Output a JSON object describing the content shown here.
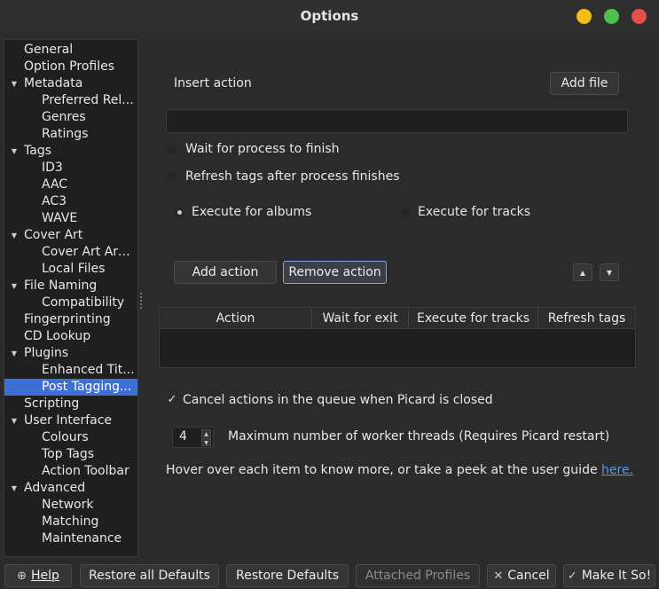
{
  "window": {
    "title": "Options",
    "colors": {
      "close": "#e2504d",
      "maximize": "#4fbf50",
      "minimize": "#f1bd17",
      "selection": "#3d6fd6",
      "link": "#4f9cf0"
    }
  },
  "tree": {
    "items": [
      {
        "label": "General",
        "level": 0
      },
      {
        "label": "Option Profiles",
        "level": 0
      },
      {
        "label": "Metadata",
        "level": 0,
        "expanded": true
      },
      {
        "label": "Preferred Rel...",
        "level": 1
      },
      {
        "label": "Genres",
        "level": 1
      },
      {
        "label": "Ratings",
        "level": 1
      },
      {
        "label": "Tags",
        "level": 0,
        "expanded": true
      },
      {
        "label": "ID3",
        "level": 1
      },
      {
        "label": "AAC",
        "level": 1
      },
      {
        "label": "AC3",
        "level": 1
      },
      {
        "label": "WAVE",
        "level": 1
      },
      {
        "label": "Cover Art",
        "level": 0,
        "expanded": true
      },
      {
        "label": "Cover Art Arc...",
        "level": 1
      },
      {
        "label": "Local Files",
        "level": 1
      },
      {
        "label": "File Naming",
        "level": 0,
        "expanded": true
      },
      {
        "label": "Compatibility",
        "level": 1
      },
      {
        "label": "Fingerprinting",
        "level": 0
      },
      {
        "label": "CD Lookup",
        "level": 0
      },
      {
        "label": "Plugins",
        "level": 0,
        "expanded": true
      },
      {
        "label": "Enhanced Tit...",
        "level": 1
      },
      {
        "label": "Post Tagging...",
        "level": 1,
        "selected": true
      },
      {
        "label": "Scripting",
        "level": 0
      },
      {
        "label": "User Interface",
        "level": 0,
        "expanded": true
      },
      {
        "label": "Colours",
        "level": 1
      },
      {
        "label": "Top Tags",
        "level": 1
      },
      {
        "label": "Action Toolbar",
        "level": 1
      },
      {
        "label": "Advanced",
        "level": 0,
        "expanded": true
      },
      {
        "label": "Network",
        "level": 1
      },
      {
        "label": "Matching",
        "level": 1
      },
      {
        "label": "Maintenance",
        "level": 1
      }
    ]
  },
  "main": {
    "insert_action_label": "Insert action",
    "add_file_button": "Add file",
    "command_value": "",
    "wait_process_label": "Wait for process to finish",
    "refresh_tags_label": "Refresh tags after process finishes",
    "execute_albums_label": "Execute for albums",
    "execute_tracks_label": "Execute for tracks",
    "add_action_button": "Add action",
    "remove_action_button": "Remove action",
    "table": {
      "columns": [
        "Action",
        "Wait for exit",
        "Execute for tracks",
        "Refresh tags"
      ]
    },
    "cancel_queue_label": "Cancel actions in the queue when Picard is closed",
    "threads_value": "4",
    "threads_label": "Maximum number of worker threads (Requires Picard restart)",
    "hint_text": "Hover over each item to know more, or take a peek at the user guide ",
    "hint_link": "here."
  },
  "footer": {
    "help": "Help",
    "restore_all": "Restore all Defaults",
    "restore": "Restore Defaults",
    "attached_profiles": "Attached Profiles",
    "cancel": "Cancel",
    "ok": "Make It So!"
  }
}
